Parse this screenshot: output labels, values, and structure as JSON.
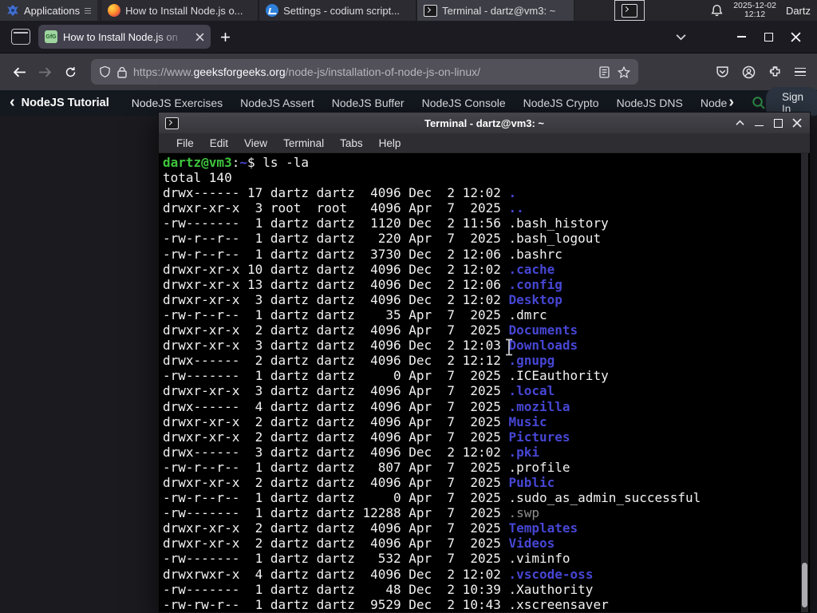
{
  "panel": {
    "applications_label": "Applications",
    "windows": [
      {
        "label": "How to Install Node.js o...",
        "icon": "firefox-icon"
      },
      {
        "label": "Settings - codium script...",
        "icon": "vscodium-icon"
      },
      {
        "label": "Terminal - dartz@vm3: ~",
        "icon": "terminal-icon",
        "active": true
      }
    ],
    "launcher_icon": "terminal-icon",
    "clock": {
      "date": "2025-12-02",
      "time": "12:12"
    },
    "username": "Dartz"
  },
  "browser": {
    "tab": {
      "title": "How to Install Node.js on",
      "favicon_text": "GfG"
    },
    "url": {
      "prefix": "https://www.",
      "domain": "geeksforgeeks.org",
      "path": "/node-js/installation-of-node-js-on-linux/"
    }
  },
  "gfg_nav": {
    "back_chevron": "‹",
    "active_item": "NodeJS Tutorial",
    "items": [
      "NodeJS Exercises",
      "NodeJS Assert",
      "NodeJS Buffer",
      "NodeJS Console",
      "NodeJS Crypto",
      "NodeJS DNS",
      "Node"
    ],
    "more_chevron": "›",
    "sign_in_label": "Sign In",
    "accent_green": "#2f8d46"
  },
  "terminal": {
    "title": "Terminal - dartz@vm3: ~",
    "menu": [
      "File",
      "Edit",
      "View",
      "Terminal",
      "Tabs",
      "Help"
    ],
    "colors": {
      "background": "#000000",
      "foreground": "#f2f2f2",
      "prompt_green": "#3ec43e",
      "directory_blue": "#4646d4",
      "dim_gray": "#8f8f8f"
    },
    "lines": [
      {
        "segs": [
          {
            "t": "dartz@vm3",
            "c": "green"
          },
          {
            "t": ":",
            "c": "fg"
          },
          {
            "t": "~",
            "c": "blue"
          },
          {
            "t": "$ ls -la",
            "c": "fg"
          }
        ]
      },
      {
        "segs": [
          {
            "t": "total 140",
            "c": "fg"
          }
        ]
      },
      {
        "segs": [
          {
            "t": "drwx------ 17 dartz dartz  4096 Dec  2 12:02 ",
            "c": "fg"
          },
          {
            "t": ".",
            "c": "blue"
          }
        ]
      },
      {
        "segs": [
          {
            "t": "drwxr-xr-x  3 root  root   4096 Apr  7  2025 ",
            "c": "fg"
          },
          {
            "t": "..",
            "c": "blue"
          }
        ]
      },
      {
        "segs": [
          {
            "t": "-rw-------  1 dartz dartz  1120 Dec  2 11:56 .bash_history",
            "c": "fg"
          }
        ]
      },
      {
        "segs": [
          {
            "t": "-rw-r--r--  1 dartz dartz   220 Apr  7  2025 .bash_logout",
            "c": "fg"
          }
        ]
      },
      {
        "segs": [
          {
            "t": "-rw-r--r--  1 dartz dartz  3730 Dec  2 12:06 .bashrc",
            "c": "fg"
          }
        ]
      },
      {
        "segs": [
          {
            "t": "drwxr-xr-x 10 dartz dartz  4096 Dec  2 12:02 ",
            "c": "fg"
          },
          {
            "t": ".cache",
            "c": "blue"
          }
        ]
      },
      {
        "segs": [
          {
            "t": "drwxr-xr-x 13 dartz dartz  4096 Dec  2 12:06 ",
            "c": "fg"
          },
          {
            "t": ".config",
            "c": "blue"
          }
        ]
      },
      {
        "segs": [
          {
            "t": "drwxr-xr-x  3 dartz dartz  4096 Dec  2 12:02 ",
            "c": "fg"
          },
          {
            "t": "Desktop",
            "c": "blue"
          }
        ]
      },
      {
        "segs": [
          {
            "t": "-rw-r--r--  1 dartz dartz    35 Apr  7  2025 .dmrc",
            "c": "fg"
          }
        ]
      },
      {
        "segs": [
          {
            "t": "drwxr-xr-x  2 dartz dartz  4096 Apr  7  2025 ",
            "c": "fg"
          },
          {
            "t": "Documents",
            "c": "blue"
          }
        ]
      },
      {
        "segs": [
          {
            "t": "drwxr-xr-x  3 dartz dartz  4096 Dec  2 12:03 ",
            "c": "fg"
          },
          {
            "t": "Downloads",
            "c": "blue"
          }
        ]
      },
      {
        "segs": [
          {
            "t": "drwx------  2 dartz dartz  4096 Dec  2 12:12 ",
            "c": "fg"
          },
          {
            "t": ".gnupg",
            "c": "blue"
          }
        ]
      },
      {
        "segs": [
          {
            "t": "-rw-------  1 dartz dartz     0 Apr  7  2025 .ICEauthority",
            "c": "fg"
          }
        ]
      },
      {
        "segs": [
          {
            "t": "drwxr-xr-x  3 dartz dartz  4096 Apr  7  2025 ",
            "c": "fg"
          },
          {
            "t": ".local",
            "c": "blue"
          }
        ]
      },
      {
        "segs": [
          {
            "t": "drwx------  4 dartz dartz  4096 Apr  7  2025 ",
            "c": "fg"
          },
          {
            "t": ".mozilla",
            "c": "blue"
          }
        ]
      },
      {
        "segs": [
          {
            "t": "drwxr-xr-x  2 dartz dartz  4096 Apr  7  2025 ",
            "c": "fg"
          },
          {
            "t": "Music",
            "c": "blue"
          }
        ]
      },
      {
        "segs": [
          {
            "t": "drwxr-xr-x  2 dartz dartz  4096 Apr  7  2025 ",
            "c": "fg"
          },
          {
            "t": "Pictures",
            "c": "blue"
          }
        ]
      },
      {
        "segs": [
          {
            "t": "drwx------  3 dartz dartz  4096 Dec  2 12:02 ",
            "c": "fg"
          },
          {
            "t": ".pki",
            "c": "blue"
          }
        ]
      },
      {
        "segs": [
          {
            "t": "-rw-r--r--  1 dartz dartz   807 Apr  7  2025 .profile",
            "c": "fg"
          }
        ]
      },
      {
        "segs": [
          {
            "t": "drwxr-xr-x  2 dartz dartz  4096 Apr  7  2025 ",
            "c": "fg"
          },
          {
            "t": "Public",
            "c": "blue"
          }
        ]
      },
      {
        "segs": [
          {
            "t": "-rw-r--r--  1 dartz dartz     0 Apr  7  2025 .sudo_as_admin_successful",
            "c": "fg"
          }
        ]
      },
      {
        "segs": [
          {
            "t": "-rw-------  1 dartz dartz 12288 Apr  7  2025 ",
            "c": "fg"
          },
          {
            "t": ".swp",
            "c": "dim"
          }
        ]
      },
      {
        "segs": [
          {
            "t": "drwxr-xr-x  2 dartz dartz  4096 Apr  7  2025 ",
            "c": "fg"
          },
          {
            "t": "Templates",
            "c": "blue"
          }
        ]
      },
      {
        "segs": [
          {
            "t": "drwxr-xr-x  2 dartz dartz  4096 Apr  7  2025 ",
            "c": "fg"
          },
          {
            "t": "Videos",
            "c": "blue"
          }
        ]
      },
      {
        "segs": [
          {
            "t": "-rw-------  1 dartz dartz   532 Apr  7  2025 .viminfo",
            "c": "fg"
          }
        ]
      },
      {
        "segs": [
          {
            "t": "drwxrwxr-x  4 dartz dartz  4096 Dec  2 12:02 ",
            "c": "fg"
          },
          {
            "t": ".vscode-oss",
            "c": "blue"
          }
        ]
      },
      {
        "segs": [
          {
            "t": "-rw-------  1 dartz dartz    48 Dec  2 10:39 .Xauthority",
            "c": "fg"
          }
        ]
      },
      {
        "segs": [
          {
            "t": "-rw-rw-r--  1 dartz dartz  9529 Dec  2 10:43 .xscreensaver",
            "c": "fg"
          }
        ]
      }
    ]
  }
}
